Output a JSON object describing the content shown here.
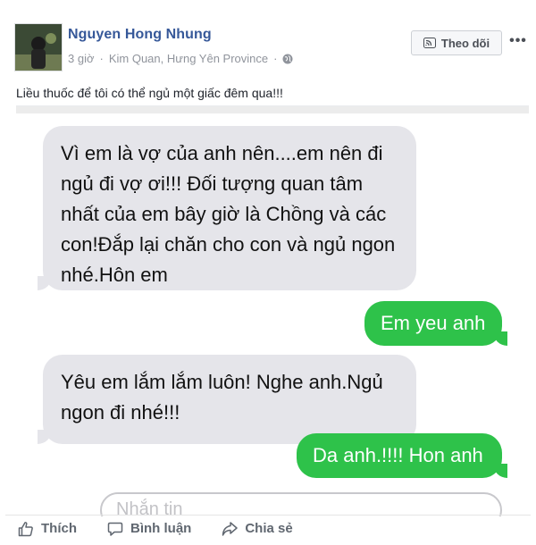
{
  "post": {
    "author": "Nguyen Hong Nhung",
    "time": "3 giờ",
    "location": "Kim Quan, Hưng Yên Province",
    "caption": "Liều thuốc để tôi có thể ngủ một giấc đêm qua!!!",
    "follow_label": "Theo dõi",
    "more_label": "•••"
  },
  "chat": {
    "messages": [
      {
        "side": "in",
        "text": "Vì em là vợ của anh nên....em nên đi ngủ đi vợ ơi!!! Đối tượng quan tâm nhất của em bây giờ là Chồng và các con!Đắp lại chăn cho con và ngủ ngon nhé.Hôn em"
      },
      {
        "side": "out",
        "text": "Em yeu anh"
      },
      {
        "side": "in",
        "text": "Yêu em lắm lắm luôn! Nghe anh.Ngủ ngon đi nhé!!!"
      },
      {
        "side": "out",
        "text": "Da anh.!!!! Hon anh"
      }
    ],
    "input_placeholder": "Nhắn tin"
  },
  "actions": {
    "like": "Thích",
    "comment": "Bình luận",
    "share": "Chia sẻ"
  },
  "colors": {
    "link": "#365899",
    "incoming_bubble": "#e5e5ea",
    "outgoing_bubble": "#2ec24a"
  }
}
